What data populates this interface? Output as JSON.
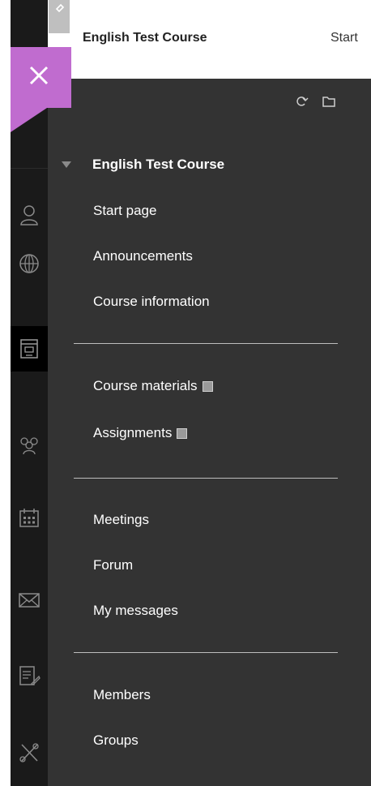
{
  "header": {
    "course_title": "English Test Course",
    "breadcrumb_partial": "Start"
  },
  "menu": {
    "root_label": "English Test Course",
    "groups": [
      {
        "items": [
          {
            "label": "Start page"
          },
          {
            "label": "Announcements"
          },
          {
            "label": "Course information"
          }
        ]
      },
      {
        "items": [
          {
            "label": "Course materials"
          },
          {
            "label": "Assignments"
          }
        ]
      },
      {
        "items": [
          {
            "label": "Meetings"
          },
          {
            "label": "Forum"
          },
          {
            "label": "My messages"
          }
        ]
      },
      {
        "items": [
          {
            "label": "Members"
          },
          {
            "label": "Groups"
          }
        ]
      }
    ]
  },
  "rail": {
    "icons": [
      "user-icon",
      "globe-icon",
      "course-icon",
      "people-icon",
      "calendar-icon",
      "mail-icon",
      "document-edit-icon",
      "tools-icon"
    ],
    "active": "course-icon"
  },
  "colors": {
    "accent": "#c06ccf",
    "panel": "#333333",
    "rail": "#1a1a1a"
  }
}
